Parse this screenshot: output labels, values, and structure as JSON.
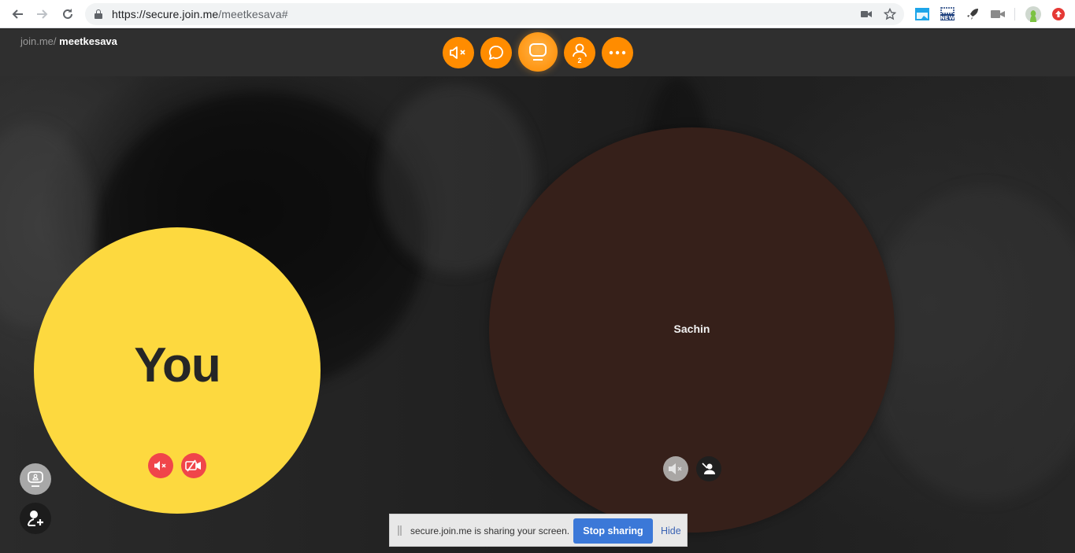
{
  "browser": {
    "url_host": "https://secure.join.me",
    "url_path": "/meetkesava#",
    "nav": {
      "back": "back-icon",
      "forward": "forward-icon",
      "reload": "reload-icon"
    },
    "omnibox_icons": [
      "camera-icon",
      "star-icon"
    ],
    "extensions": [
      "window-extension-icon",
      "new-extension-icon",
      "rocket-extension-icon",
      "video-extension-icon",
      "profile-avatar-icon",
      "red-update-icon"
    ]
  },
  "app": {
    "brand_prefix": "join.me/",
    "room_name": "meetkesava",
    "toolbar": [
      {
        "name": "mute-audio",
        "icon": "speaker-muted-icon"
      },
      {
        "name": "chat",
        "icon": "chat-bubble-icon"
      },
      {
        "name": "screen-share",
        "icon": "monitor-icon",
        "active": true
      },
      {
        "name": "participants",
        "icon": "person-icon",
        "count": "2"
      },
      {
        "name": "more",
        "icon": "more-dots-icon"
      }
    ],
    "participants": [
      {
        "label": "You",
        "color": "#fdd93f",
        "audio_muted": true,
        "video_off": true
      },
      {
        "label": "Sachin",
        "color": "#36201a",
        "audio_muted": true,
        "video": "unavailable"
      }
    ],
    "side_buttons": [
      {
        "name": "presenter-view",
        "icon": "monitor-person-icon"
      },
      {
        "name": "invite",
        "icon": "add-person-icon"
      }
    ]
  },
  "share_banner": {
    "message": "secure.join.me is sharing your screen.",
    "stop_label": "Stop sharing",
    "hide_label": "Hide"
  },
  "colors": {
    "accent": "#ff8c00",
    "mute_red": "#f0454a",
    "stop_blue": "#3b78d8"
  }
}
